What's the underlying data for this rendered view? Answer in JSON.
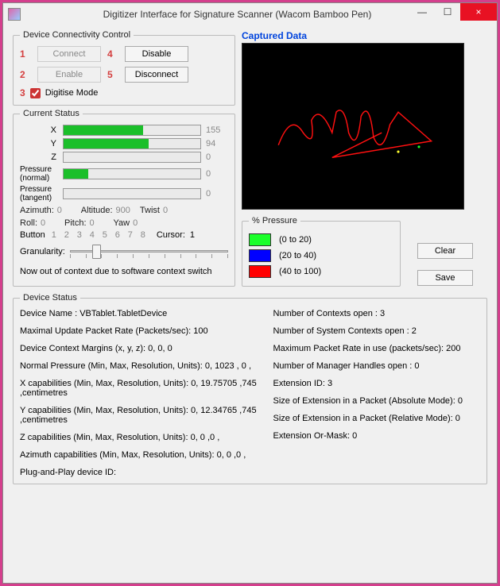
{
  "window": {
    "title": "Digitizer Interface for Signature Scanner (Wacom Bamboo Pen)",
    "min": "—",
    "restore": "☐",
    "close": "×"
  },
  "connectivity": {
    "legend": "Device Connectivity Control",
    "n1": "1",
    "connect": "Connect",
    "n4": "4",
    "disable": "Disable",
    "n2": "2",
    "enable": "Enable",
    "n5": "5",
    "disconnect": "Disconnect",
    "n3": "3",
    "digitise": "Digitise Mode"
  },
  "status": {
    "legend": "Current Status",
    "x_label": "X",
    "x_val": "155",
    "x_pct": 58,
    "y_label": "Y",
    "y_val": "94",
    "y_pct": 62,
    "z_label": "Z",
    "z_val": "0",
    "z_pct": 0,
    "pn_label": "Pressure (normal)",
    "pn_val": "0",
    "pn_pct": 18,
    "pt_label": "Pressure (tangent)",
    "pt_val": "0",
    "pt_pct": 0,
    "azimuth_k": "Azimuth:",
    "azimuth_v": "0",
    "altitude_k": "Altitude:",
    "altitude_v": "900",
    "twist_k": "Twist",
    "twist_v": "0",
    "roll_k": "Roll:",
    "roll_v": "0",
    "pitch_k": "Pitch:",
    "pitch_v": "0",
    "yaw_k": "Yaw",
    "yaw_v": "0",
    "button_k": "Button",
    "b1": "1",
    "b2": "2",
    "b3": "3",
    "b4": "4",
    "b5": "5",
    "b6": "6",
    "b7": "7",
    "b8": "8",
    "cursor_k": "Cursor:",
    "cursor_v": "1",
    "gran_k": "Granularity:",
    "ctx_msg": "Now out of context due to software context switch"
  },
  "captured": {
    "title": "Captured Data",
    "clear": "Clear",
    "save": "Save"
  },
  "pressure_legend": {
    "title": "% Pressure",
    "r1_color": "#1bff2a",
    "r1_label": "(0 to 20)",
    "r2_color": "#0000ff",
    "r2_label": "(20 to 40)",
    "r3_color": "#ff0000",
    "r3_label": "(40 to 100)"
  },
  "device_status": {
    "legend": "Device Status",
    "l1": "Device Name : VBTablet.TabletDevice",
    "l2": "Maximal Update Packet Rate (Packets/sec): 100",
    "l3": "Device Context Margins (x, y, z): 0, 0, 0",
    "l4": "Normal Pressure (Min, Max, Resolution, Units): 0, 1023 , 0 ,",
    "l5": "X capabilities (Min, Max, Resolution, Units): 0, 19.75705 ,745 ,centimetres",
    "l6": "Y capabilities (Min, Max, Resolution, Units): 0, 12.34765 ,745 ,centimetres",
    "l7": "Z capabilities (Min, Max, Resolution, Units): 0, 0 ,0 ,",
    "l8": "Azimuth capabilities (Min, Max, Resolution, Units): 0, 0 ,0 ,",
    "l9": "Plug-and-Play device ID:",
    "r1": "Number of Contexts open : 3",
    "r2": "Number of System Contexts open : 2",
    "r3": "Maximum Packet Rate in use (packets/sec): 200",
    "r4": "Number of Manager Handles open : 0",
    "r5": "Extension ID: 3",
    "r6": "Size of Extension in a Packet (Absolute Mode): 0",
    "r7": "Size of Extension in a Packet (Relative Mode): 0",
    "r8": "Extension Or-Mask: 0"
  }
}
